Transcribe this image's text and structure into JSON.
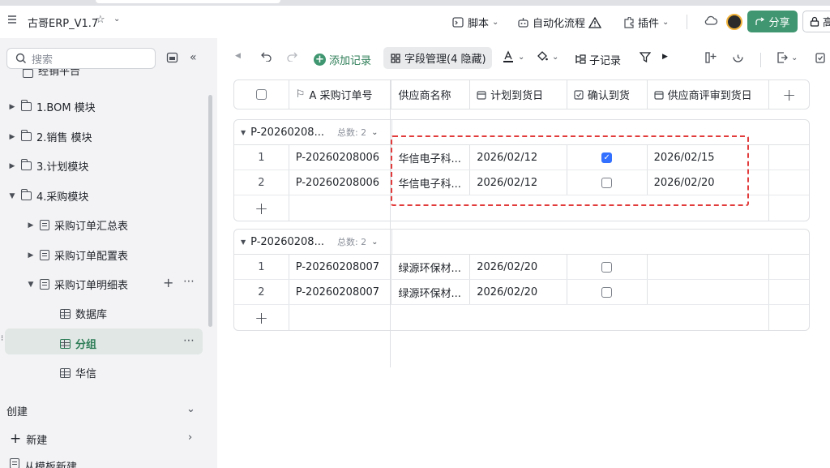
{
  "header": {
    "app_title": "古哥ERP_V1.7",
    "script_label": "脚本",
    "automation_label": "自动化流程",
    "plugin_label": "插件",
    "share_label": "分享",
    "lock_label": "高"
  },
  "sidebar": {
    "search_placeholder": "搜索",
    "partial_item": "经销平台",
    "items": [
      {
        "label": "1.BOM 模块"
      },
      {
        "label": "2.销售 模块"
      },
      {
        "label": "3.计划模块"
      },
      {
        "label": "4.采购模块"
      },
      {
        "label": "采购订单汇总表"
      },
      {
        "label": "采购订单配置表"
      },
      {
        "label": "采购订单明细表"
      },
      {
        "label": "数据库"
      },
      {
        "label": "分组"
      },
      {
        "label": "华信"
      }
    ],
    "create_label": "创建",
    "new_label": "新建",
    "template_label": "从模板新建"
  },
  "toolbar": {
    "add_record": "添加记录",
    "field_manage": "字段管理(4 隐藏)",
    "sub_record": "子记录"
  },
  "table": {
    "columns": [
      "A 采购订单号",
      "供应商名称",
      "计划到货日",
      "确认到货",
      "供应商评审到货日"
    ],
    "groups": [
      {
        "title": "P-20260208...",
        "count_label": "总数: 2",
        "rows": [
          {
            "num": "1",
            "order": "P-20260208006",
            "supplier": "华信电子科...",
            "plan_date": "2026/02/12",
            "confirmed": true,
            "eval_date": "2026/02/15"
          },
          {
            "num": "2",
            "order": "P-20260208006",
            "supplier": "华信电子科...",
            "plan_date": "2026/02/12",
            "confirmed": false,
            "eval_date": "2026/02/20"
          }
        ]
      },
      {
        "title": "P-20260208...",
        "count_label": "总数: 2",
        "rows": [
          {
            "num": "1",
            "order": "P-20260208007",
            "supplier": "绿源环保材...",
            "plan_date": "2026/02/20",
            "confirmed": false,
            "eval_date": ""
          },
          {
            "num": "2",
            "order": "P-20260208007",
            "supplier": "绿源环保材...",
            "plan_date": "2026/02/20",
            "confirmed": false,
            "eval_date": ""
          }
        ]
      }
    ]
  },
  "colors": {
    "accent": "#3f9670",
    "checkbox_on": "#3370ff",
    "highlight_dash": "#e23b3b"
  }
}
